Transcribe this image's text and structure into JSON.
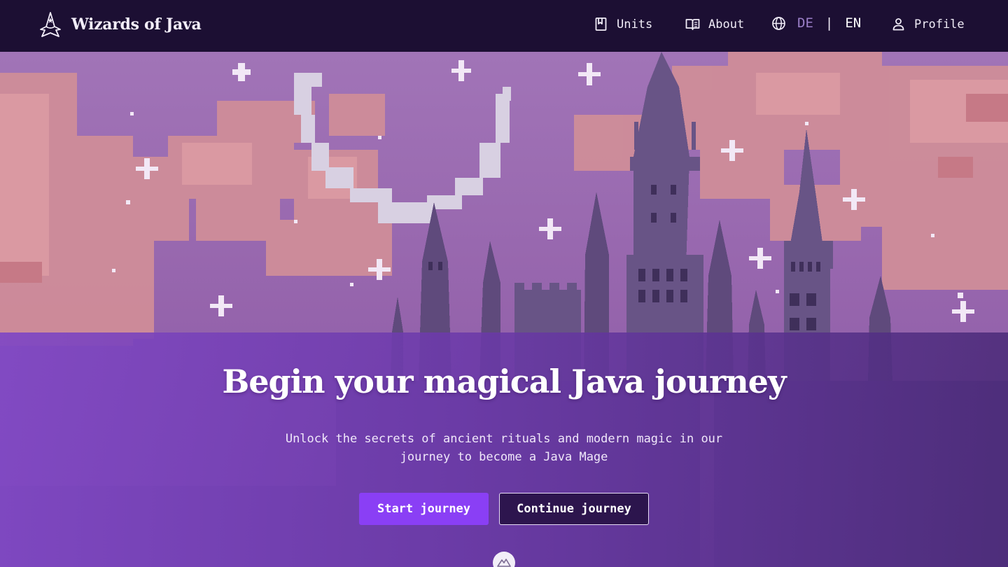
{
  "nav": {
    "brand": "Wizards of Java",
    "items": {
      "units": "Units",
      "about": "About",
      "profile": "Profile"
    },
    "language": {
      "de": "DE",
      "separator": "|",
      "en": "EN",
      "active": "EN"
    }
  },
  "hero": {
    "title": "Begin your magical Java journey",
    "subtitle": "Unlock the secrets of ancient rituals and modern magic in our journey to become a Java Mage",
    "buttons": {
      "start": "Start journey",
      "continue": "Continue journey"
    }
  },
  "colors": {
    "navbar_bg": "#1c0f33",
    "accent": "#8a3ff5",
    "sky": "#9a68b0",
    "clouds": "#d08a96",
    "overlay": "#7a46c0",
    "inactive_lang": "#9b7fc8"
  },
  "icons": {
    "brand": "wizard-hat-icon",
    "units": "bookmark-icon",
    "about": "book-icon",
    "language": "globe-icon",
    "profile": "user-icon",
    "scroll": "mountain-icon"
  }
}
